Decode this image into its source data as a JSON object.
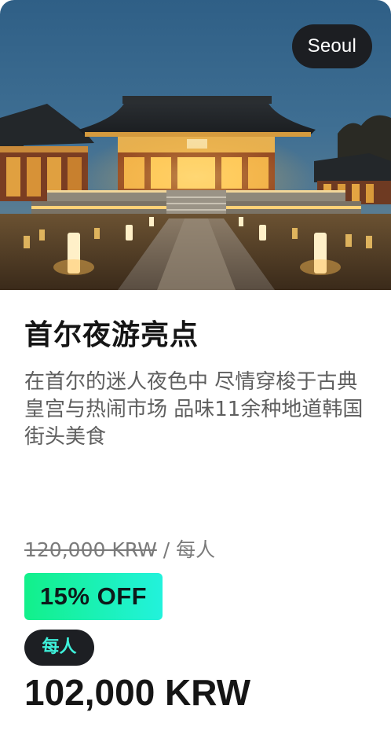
{
  "hero": {
    "image": "seoul-palace-night-photo",
    "location": "Seoul"
  },
  "card": {
    "title": "首尔夜游亮点",
    "description": "在首尔的迷人夜色中 尽情穿梭于古典皇宫与热闹市场 品味11余种地道韩国街头美食"
  },
  "pricing": {
    "original_price": "120,000 KRW",
    "per_person_suffix": " / 每人",
    "discount": "15% OFF",
    "unit_label": "每人",
    "final_price": "102,000 KRW"
  },
  "colors": {
    "badge_dark": "#1c1e22",
    "discount_gradient_start": "#12f08a",
    "discount_gradient_end": "#22f2dc",
    "unit_text": "#3ef0da"
  }
}
